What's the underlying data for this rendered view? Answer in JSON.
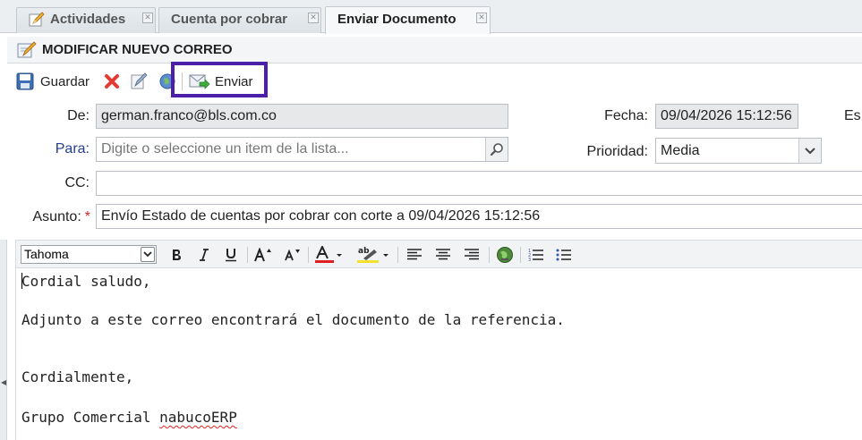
{
  "tabs": [
    {
      "label": "Actividades",
      "active": false
    },
    {
      "label": "Cuenta por cobrar",
      "active": false
    },
    {
      "label": "Enviar Documento",
      "active": true
    }
  ],
  "tab_close_glyph": "✕",
  "title": "MODIFICAR NUEVO CORREO",
  "toolbar": {
    "save_label": "Guardar",
    "send_label": "Enviar"
  },
  "form": {
    "from_label": "De:",
    "from_value": "german.franco@bls.com.co",
    "to_label": "Para:",
    "to_placeholder": "Digite o seleccione un item de la lista...",
    "cc_label": "CC:",
    "cc_value": "",
    "subject_label": "Asunto:",
    "subject_required": "*",
    "subject_value": "Envío Estado de cuentas por cobrar con corte a 09/04/2026 15:12:56",
    "date_label": "Fecha:",
    "date_value": "09/04/2026 15:12:56",
    "priority_label": "Prioridad:",
    "priority_value": "Media",
    "cut_label": "Es"
  },
  "editor": {
    "font": "Tahoma",
    "lines": [
      "Cordial saludo,",
      "Adjunto a este correo encontrará el documento de la referencia.",
      "Cordialmente,"
    ],
    "signature_prefix": "Grupo Comercial ",
    "signature_brand": "nabucoERP"
  },
  "colors": {
    "highlight_border": "#4b1fa8",
    "required_star": "#e02020",
    "label_blue": "#233f8f"
  }
}
